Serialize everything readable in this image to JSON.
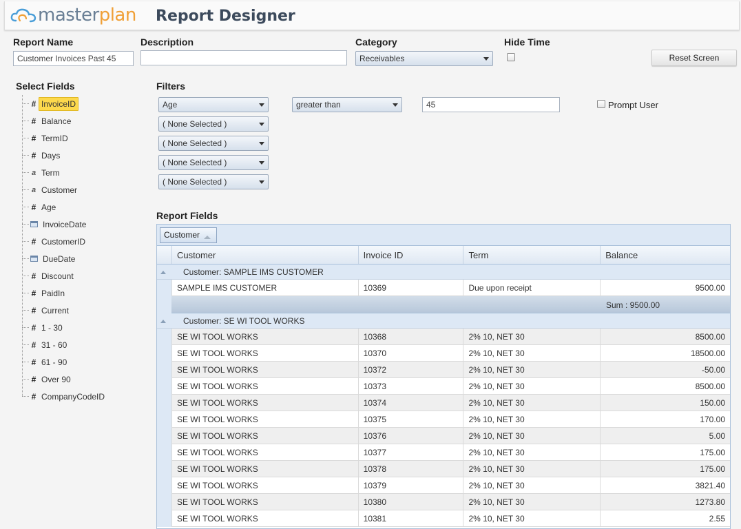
{
  "brand": {
    "logo_part1": "master",
    "logo_part2": "plan",
    "logo_icon": "cloud-icon"
  },
  "app_title": "Report Designer",
  "form": {
    "report_name_label": "Report Name",
    "report_name_value": "Customer Invoices Past 45",
    "description_label": "Description",
    "description_value": "",
    "category_label": "Category",
    "category_value": "Receivables",
    "hide_time_label": "Hide Time",
    "hide_time_checked": false,
    "reset_button": "Reset Screen"
  },
  "select_fields": {
    "title": "Select Fields",
    "items": [
      {
        "label": "InvoiceID",
        "icon": "number-icon",
        "selected": true
      },
      {
        "label": "Balance",
        "icon": "number-icon"
      },
      {
        "label": "TermID",
        "icon": "number-icon"
      },
      {
        "label": "Days",
        "icon": "number-icon"
      },
      {
        "label": "Term",
        "icon": "text-icon"
      },
      {
        "label": "Customer",
        "icon": "text-icon"
      },
      {
        "label": "Age",
        "icon": "number-icon"
      },
      {
        "label": "InvoiceDate",
        "icon": "calendar-icon"
      },
      {
        "label": "CustomerID",
        "icon": "number-icon"
      },
      {
        "label": "DueDate",
        "icon": "calendar-icon"
      },
      {
        "label": "Discount",
        "icon": "number-icon"
      },
      {
        "label": "PaidIn",
        "icon": "number-icon"
      },
      {
        "label": "Current",
        "icon": "number-icon"
      },
      {
        "label": "1 - 30",
        "icon": "number-icon"
      },
      {
        "label": "31 - 60",
        "icon": "number-icon"
      },
      {
        "label": "61 - 90",
        "icon": "number-icon"
      },
      {
        "label": "Over 90",
        "icon": "number-icon"
      },
      {
        "label": "CompanyCodeID",
        "icon": "number-icon"
      }
    ]
  },
  "filters": {
    "title": "Filters",
    "field_1": "Age",
    "operator_1": "greater than",
    "value_1": "45",
    "prompt_user_label": "Prompt User",
    "prompt_user_checked": false,
    "empty_label": "( None Selected )"
  },
  "report_fields": {
    "title": "Report Fields",
    "group_chip": "Customer",
    "columns": [
      "Customer",
      "Invoice ID",
      "Term",
      "Balance"
    ],
    "groups": [
      {
        "header": "Customer: SAMPLE IMS CUSTOMER",
        "rows": [
          [
            "SAMPLE IMS CUSTOMER",
            "10369",
            "Due upon receipt",
            "9500.00"
          ]
        ],
        "sum": "Sum : 9500.00"
      },
      {
        "header": "Customer: SE WI TOOL WORKS",
        "rows": [
          [
            "SE WI TOOL WORKS",
            "10368",
            "2% 10, NET 30",
            "8500.00"
          ],
          [
            "SE WI TOOL WORKS",
            "10370",
            "2% 10, NET 30",
            "18500.00"
          ],
          [
            "SE WI TOOL WORKS",
            "10372",
            "2% 10, NET 30",
            "-50.00"
          ],
          [
            "SE WI TOOL WORKS",
            "10373",
            "2% 10, NET 30",
            "8500.00"
          ],
          [
            "SE WI TOOL WORKS",
            "10374",
            "2% 10, NET 30",
            "150.00"
          ],
          [
            "SE WI TOOL WORKS",
            "10375",
            "2% 10, NET 30",
            "170.00"
          ],
          [
            "SE WI TOOL WORKS",
            "10376",
            "2% 10, NET 30",
            "5.00"
          ],
          [
            "SE WI TOOL WORKS",
            "10377",
            "2% 10, NET 30",
            "175.00"
          ],
          [
            "SE WI TOOL WORKS",
            "10378",
            "2% 10, NET 30",
            "175.00"
          ],
          [
            "SE WI TOOL WORKS",
            "10379",
            "2% 10, NET 30",
            "3821.40"
          ],
          [
            "SE WI TOOL WORKS",
            "10380",
            "2% 10, NET 30",
            "1273.80"
          ],
          [
            "SE WI TOOL WORKS",
            "10381",
            "2% 10, NET 30",
            "2.55"
          ]
        ]
      }
    ]
  }
}
